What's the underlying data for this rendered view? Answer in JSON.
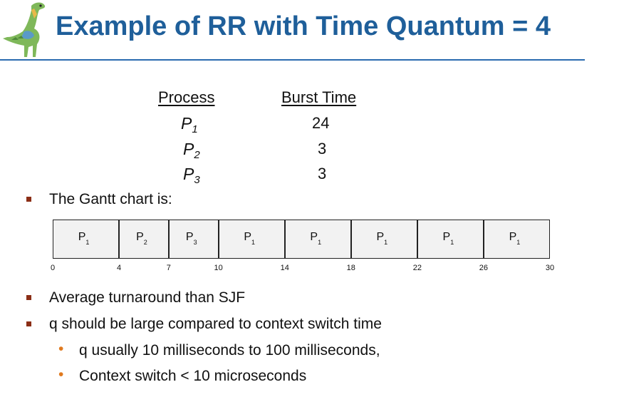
{
  "title": "Example of RR with Time Quantum = 4",
  "table": {
    "headers": [
      "Process",
      "Burst Time"
    ],
    "rows": [
      {
        "process": "P",
        "sub": "1",
        "burst": "24"
      },
      {
        "process": "P",
        "sub": "2",
        "burst": "3"
      },
      {
        "process": "P",
        "sub": "3",
        "burst": "3"
      }
    ]
  },
  "bullets": {
    "gantt_intro": "The Gantt chart is:",
    "b2": "Average turnaround than SJF",
    "b3": "q should be large compared to context switch time",
    "sub1": "q usually 10 milliseconds  to 100 milliseconds,",
    "sub2": "Context switch < 10 microseconds"
  },
  "gantt": {
    "blocks": [
      {
        "process": "P",
        "sub": "1",
        "start": 0,
        "end": 4
      },
      {
        "process": "P",
        "sub": "2",
        "start": 4,
        "end": 7
      },
      {
        "process": "P",
        "sub": "3",
        "start": 7,
        "end": 10
      },
      {
        "process": "P",
        "sub": "1",
        "start": 10,
        "end": 14
      },
      {
        "process": "P",
        "sub": "1",
        "start": 14,
        "end": 18
      },
      {
        "process": "P",
        "sub": "1",
        "start": 18,
        "end": 22
      },
      {
        "process": "P",
        "sub": "1",
        "start": 22,
        "end": 26
      },
      {
        "process": "P",
        "sub": "1",
        "start": 26,
        "end": 30
      }
    ],
    "ticks": [
      "0",
      "4",
      "7",
      "10",
      "14",
      "18",
      "22",
      "26",
      "30"
    ],
    "total": 30
  },
  "colors": {
    "title": "#1f5f9a",
    "rule": "#2a6bb0",
    "square_bullet": "#8b2e16",
    "dot_bullet": "#e07a1f"
  },
  "icons": {
    "logo": "dinosaur-logo-icon"
  }
}
